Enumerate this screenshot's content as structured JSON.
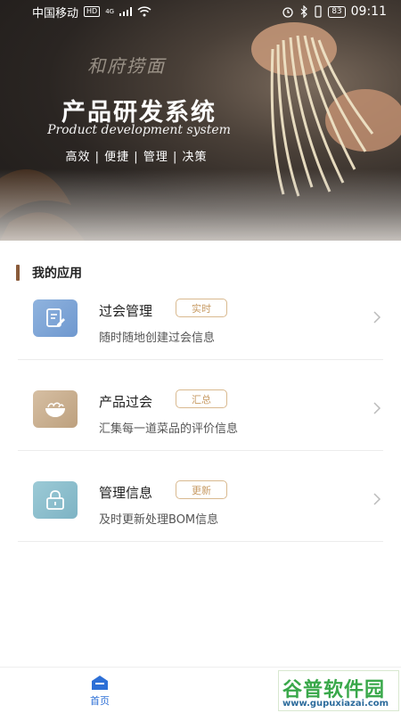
{
  "status_bar": {
    "carrier": "中国移动",
    "hd": "HD",
    "network": "4G",
    "battery": "83",
    "time": "09:11"
  },
  "hero": {
    "brand_logo": "和府捞面",
    "title": "产品研发系统",
    "subtitle": "Product development system",
    "tags": "高效 | 便捷 | 管理 | 决策"
  },
  "section": {
    "title": "我的应用"
  },
  "apps": [
    {
      "name": "过会管理",
      "tag": "实时",
      "description": "随时随地创建过会信息",
      "icon": "document-edit-icon",
      "icon_color": "#7ea6d6"
    },
    {
      "name": "产品过会",
      "tag": "汇总",
      "description": "汇集每一道菜品的评价信息",
      "icon": "noodle-bowl-icon",
      "icon_color": "#c9ae8e"
    },
    {
      "name": "管理信息",
      "tag": "更新",
      "description": "及时更新处理BOM信息",
      "icon": "lock-icon",
      "icon_color": "#86bccb"
    }
  ],
  "bottom_nav": {
    "home_label": "首页",
    "accent": "#2d6fd6"
  },
  "watermark": {
    "main": "谷普软件园",
    "url": "www.gupuxiazai.com"
  }
}
